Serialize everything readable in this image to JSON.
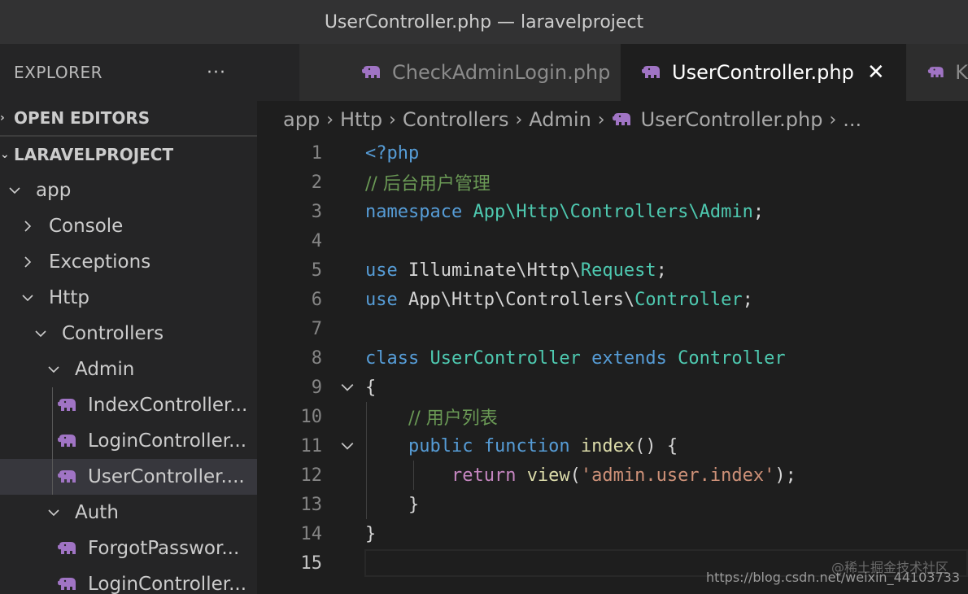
{
  "window": {
    "title": "UserController.php — laravelproject"
  },
  "sidebar": {
    "header_label": "EXPLORER",
    "more_label": "···",
    "sections": {
      "open_editors": "OPEN EDITORS",
      "project": "LARAVELPROJECT"
    },
    "tree": [
      {
        "label": "app",
        "type": "folder",
        "expanded": true
      },
      {
        "label": "Console",
        "type": "folder",
        "expanded": false
      },
      {
        "label": "Exceptions",
        "type": "folder",
        "expanded": false
      },
      {
        "label": "Http",
        "type": "folder",
        "expanded": true
      },
      {
        "label": "Controllers",
        "type": "folder",
        "expanded": true
      },
      {
        "label": "Admin",
        "type": "folder",
        "expanded": true
      },
      {
        "label": "IndexController...",
        "type": "php-file"
      },
      {
        "label": "LoginController...",
        "type": "php-file"
      },
      {
        "label": "UserController....",
        "type": "php-file",
        "selected": true
      },
      {
        "label": "Auth",
        "type": "folder",
        "expanded": true
      },
      {
        "label": "ForgotPasswor...",
        "type": "php-file"
      },
      {
        "label": "LoginController...",
        "type": "php-file"
      }
    ]
  },
  "tabs": [
    {
      "label": "CheckAdminLogin.php",
      "active": false
    },
    {
      "label": "UserController.php",
      "active": true,
      "close_label": "✕"
    },
    {
      "label": "K",
      "active": false
    }
  ],
  "breadcrumb": [
    "app",
    "Http",
    "Controllers",
    "Admin",
    "UserController.php",
    "..."
  ],
  "editor": {
    "current_line": 15,
    "lines": [
      {
        "n": "1",
        "tokens": [
          [
            "kw",
            "<?php"
          ]
        ]
      },
      {
        "n": "2",
        "tokens": [
          [
            "cm",
            "// 后台用户管理"
          ]
        ]
      },
      {
        "n": "3",
        "tokens": [
          [
            "kw",
            "namespace "
          ],
          [
            "cls",
            "App\\Http\\Controllers\\Admin"
          ],
          [
            "plain",
            ";"
          ]
        ]
      },
      {
        "n": "4",
        "tokens": []
      },
      {
        "n": "5",
        "tokens": [
          [
            "kw",
            "use "
          ],
          [
            "plain",
            "Illuminate\\Http\\"
          ],
          [
            "cls",
            "Request"
          ],
          [
            "plain",
            ";"
          ]
        ]
      },
      {
        "n": "6",
        "tokens": [
          [
            "kw",
            "use "
          ],
          [
            "plain",
            "App\\Http\\Controllers\\"
          ],
          [
            "cls",
            "Controller"
          ],
          [
            "plain",
            ";"
          ]
        ]
      },
      {
        "n": "7",
        "tokens": []
      },
      {
        "n": "8",
        "tokens": [
          [
            "kw",
            "class "
          ],
          [
            "cls",
            "UserController "
          ],
          [
            "kw",
            "extends "
          ],
          [
            "cls",
            "Controller"
          ]
        ]
      },
      {
        "n": "9",
        "tokens": [
          [
            "plain",
            "{"
          ]
        ]
      },
      {
        "n": "10",
        "tokens": [
          [
            "plain",
            "    "
          ],
          [
            "cm",
            "// 用户列表"
          ]
        ]
      },
      {
        "n": "11",
        "tokens": [
          [
            "plain",
            "    "
          ],
          [
            "kw",
            "public "
          ],
          [
            "kw",
            "function "
          ],
          [
            "fn",
            "index"
          ],
          [
            "plain",
            "() {"
          ]
        ]
      },
      {
        "n": "12",
        "tokens": [
          [
            "plain",
            "        "
          ],
          [
            "ctrl",
            "return "
          ],
          [
            "fn",
            "view"
          ],
          [
            "plain",
            "("
          ],
          [
            "str",
            "'admin.user.index'"
          ],
          [
            "plain",
            ");"
          ]
        ]
      },
      {
        "n": "13",
        "tokens": [
          [
            "plain",
            "    }"
          ]
        ]
      },
      {
        "n": "14",
        "tokens": [
          [
            "plain",
            "}"
          ]
        ]
      },
      {
        "n": "15",
        "tokens": []
      }
    ]
  },
  "watermark": {
    "line1": "@稀土掘金技术社区",
    "line2": "https://blog.csdn.net/weixin_44103733"
  },
  "colors": {
    "keyword": "#569cd6",
    "control": "#c586c0",
    "class": "#4ec9b0",
    "function": "#dcdcaa",
    "string": "#ce9178",
    "comment": "#6a9955",
    "php_icon": "#a074c4"
  }
}
